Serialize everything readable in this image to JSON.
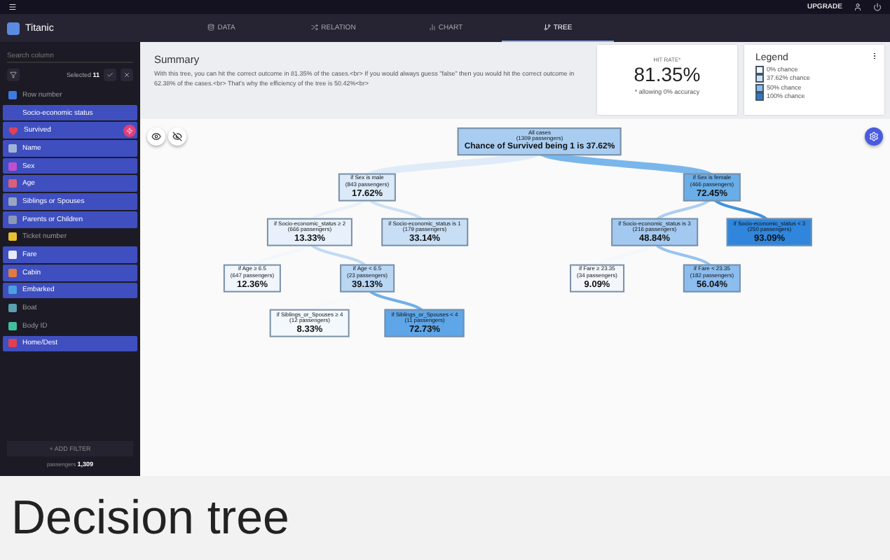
{
  "top_bar": {
    "upgrade": "UPGRADE"
  },
  "sidebar": {
    "title": "Titanic",
    "search": {
      "placeholder": "Search column"
    },
    "selected_label": "Selected",
    "selected_count": "11",
    "items": [
      {
        "label": "Row number",
        "selected": false,
        "color": "#3d7be0"
      },
      {
        "label": "Socio-economic status",
        "selected": true
      },
      {
        "label": "Survived",
        "selected": true,
        "color": "#e0405a",
        "target": true
      },
      {
        "label": "Name",
        "selected": true,
        "color": "#9fb4d8"
      },
      {
        "label": "Sex",
        "selected": true,
        "color": "#c04fd0"
      },
      {
        "label": "Age",
        "selected": true,
        "color": "#d8607a"
      },
      {
        "label": "Siblings or Spouses",
        "selected": true,
        "color": "#9aa6c0"
      },
      {
        "label": "Parents or Children",
        "selected": true,
        "color": "#8a98b8"
      },
      {
        "label": "Ticket number",
        "selected": false,
        "color": "#e8c030"
      },
      {
        "label": "Fare",
        "selected": true,
        "color": "#e8eaf6"
      },
      {
        "label": "Cabin",
        "selected": true,
        "color": "#e07a40"
      },
      {
        "label": "Embarked",
        "selected": true,
        "color": "#4aa0e0"
      },
      {
        "label": "Boat",
        "selected": false,
        "color": "#5aa0b0"
      },
      {
        "label": "Body ID",
        "selected": false,
        "color": "#40c0a0"
      },
      {
        "label": "Home/Dest",
        "selected": true,
        "color": "#e04050"
      }
    ],
    "add_filter": "+ ADD FILTER",
    "count_label": "passengers",
    "count": "1,309"
  },
  "tabs": [
    {
      "label": "DATA",
      "selected": false
    },
    {
      "label": "RELATION",
      "selected": false
    },
    {
      "label": "CHART",
      "selected": false
    },
    {
      "label": "TREE",
      "selected": true
    }
  ],
  "summary": {
    "title": "Summary",
    "text": "With this tree, you can hit the correct outcome in 81.35% of the cases.<br> If you would always guess \"false\" then you would hit the correct outcome in 62.38% of the cases.<br> That's why the efficiency of the tree is 50.42%<br>"
  },
  "hit_rate": {
    "label": "HIT RATE*",
    "value": "81.35%",
    "note": "* allowing 0% accuracy"
  },
  "legend": {
    "title": "Legend",
    "items": [
      {
        "label": "0% chance",
        "color": "#f5f9fd"
      },
      {
        "label": "37.62% chance",
        "color": "#cfe2f5"
      },
      {
        "label": "50% chance",
        "color": "#8cbdee"
      },
      {
        "label": "100% chance",
        "color": "#2f78c8"
      }
    ]
  },
  "tree": {
    "condition": "All cases",
    "passengers": "(1309 passengers)",
    "result": "Chance of Survived being 1 is 37.62%",
    "color": "#a9cdf1",
    "children": [
      {
        "condition": "if Sex is male",
        "passengers": "(843 passengers)",
        "result": "17.62%",
        "color": "#dbe9f8",
        "children": [
          {
            "condition": "if Socio-economic_status ≥ 2",
            "passengers": "(666 passengers)",
            "result": "13.33%",
            "color": "#e8f1fb",
            "children": [
              {
                "condition": "if Age ≥ 6.5",
                "passengers": "(647 passengers)",
                "result": "12.36%",
                "color": "#f0f6fc"
              },
              {
                "condition": "if Age < 6.5",
                "passengers": "(23 passengers)",
                "result": "39.13%",
                "color": "#b9d6f3",
                "children": [
                  {
                    "condition": "if Siblings_or_Spouses ≥ 4",
                    "passengers": "(12 passengers)",
                    "result": "8.33%",
                    "color": "#f3f8fd"
                  },
                  {
                    "condition": "if Siblings_or_Spouses < 4",
                    "passengers": "(11 passengers)",
                    "result": "72.73%",
                    "color": "#5ea6e8"
                  }
                ]
              }
            ]
          },
          {
            "condition": "if Socio-economic_status is 1",
            "passengers": "(179 passengers)",
            "result": "33.14%",
            "color": "#c8def5"
          }
        ]
      },
      {
        "condition": "if Sex is female",
        "passengers": "(466 passengers)",
        "result": "72.45%",
        "color": "#6aaee9",
        "children": [
          {
            "condition": "if Socio-economic_status is 3",
            "passengers": "(216 passengers)",
            "result": "48.84%",
            "color": "#a3c9f0",
            "children": [
              {
                "condition": "if Fare ≥ 23.35",
                "passengers": "(34 passengers)",
                "result": "9.09%",
                "color": "#f3f7fc"
              },
              {
                "condition": "if Fare < 23.35",
                "passengers": "(182 passengers)",
                "result": "56.04%",
                "color": "#8cbdee"
              }
            ]
          },
          {
            "condition": "if Socio-economic_status < 3",
            "passengers": "(250 passengers)",
            "result": "93.09%",
            "color": "#2f86dc"
          }
        ]
      }
    ]
  },
  "caption": "Decision tree"
}
